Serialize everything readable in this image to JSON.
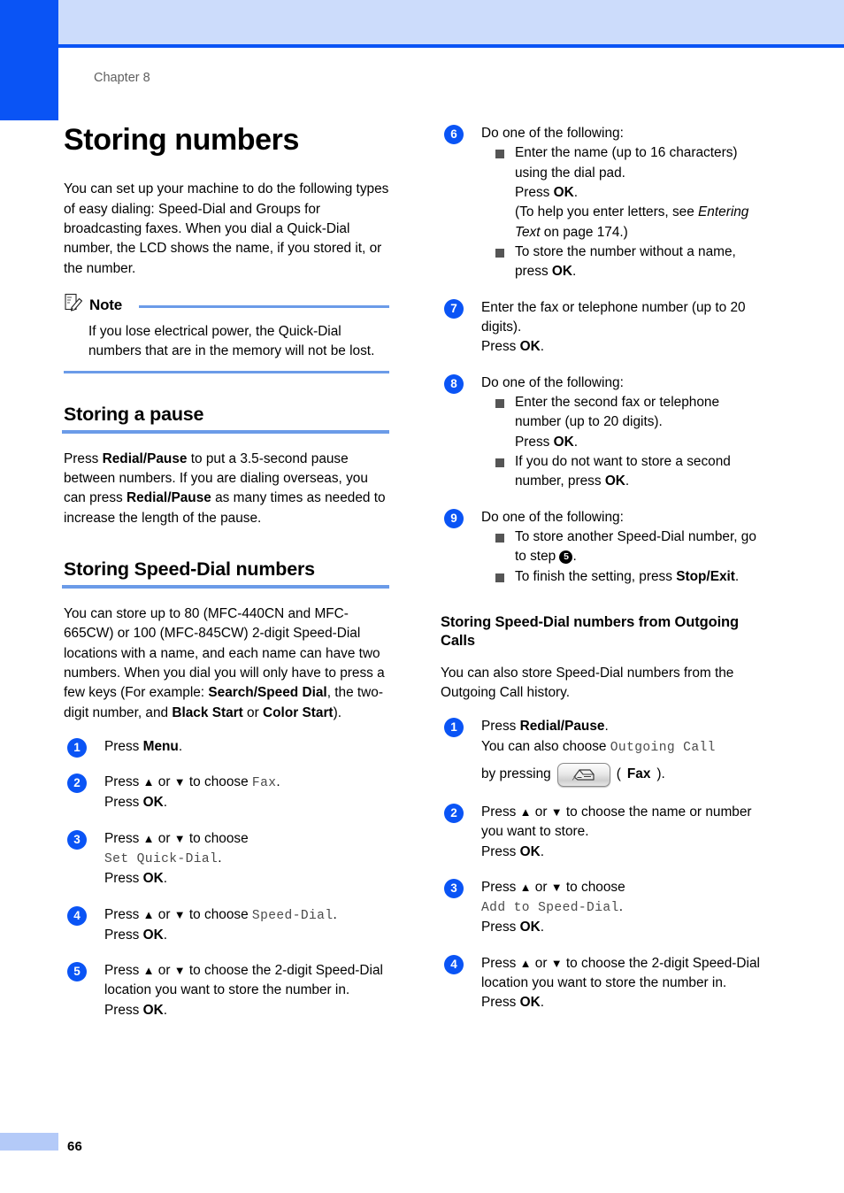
{
  "page": {
    "chapter_label": "Chapter 8",
    "page_number": "66",
    "accent_blue": "#0a54f5",
    "rule_blue": "#6b9be8",
    "band_blue": "#ccdcfb"
  },
  "title": "Storing numbers",
  "intro": "You can set up your machine to do the following types of easy dialing: Speed-Dial and Groups for broadcasting faxes. When you dial a Quick-Dial number, the LCD shows the name, if you stored it, or the number.",
  "note": {
    "title": "Note",
    "body": "If you lose electrical power, the Quick-Dial numbers that are in the memory will not be lost."
  },
  "section_pause": {
    "heading": "Storing a pause",
    "body_1": "Press ",
    "body_b1": "Redial/Pause",
    "body_2": " to put a 3.5-second pause between numbers. If you are dialing overseas, you can press ",
    "body_b2": "Redial/Pause",
    "body_3": " as many times as needed to increase the length of the pause."
  },
  "section_speed_dial": {
    "heading": "Storing Speed-Dial numbers",
    "body_1": "You can store up to 80 (MFC-440CN and MFC-665CW) or 100 (MFC-845CW) 2-digit Speed-Dial locations with a name, and each name can have two numbers. When you dial you will only have to press a few keys (For example: ",
    "body_b1": "Search/Speed Dial",
    "body_2": ", the two-digit number, and ",
    "body_b2": "Black Start",
    "body_3": " or ",
    "body_b3": "Color Start",
    "body_4": ")."
  },
  "steps_left": [
    {
      "num": "1",
      "lines": [
        {
          "parts": [
            {
              "t": "Press "
            },
            {
              "t": "Menu",
              "b": true
            },
            {
              "t": "."
            }
          ]
        }
      ]
    },
    {
      "num": "2",
      "lines": [
        {
          "parts": [
            {
              "t": "Press "
            },
            {
              "t": "▲",
              "arrow": true
            },
            {
              "t": " or "
            },
            {
              "t": "▼",
              "arrow": true
            },
            {
              "t": " to choose "
            },
            {
              "t": "Fax",
              "lcd": true
            },
            {
              "t": "."
            }
          ]
        },
        {
          "parts": [
            {
              "t": "Press "
            },
            {
              "t": "OK",
              "b": true
            },
            {
              "t": "."
            }
          ]
        }
      ]
    },
    {
      "num": "3",
      "lines": [
        {
          "parts": [
            {
              "t": "Press "
            },
            {
              "t": "▲",
              "arrow": true
            },
            {
              "t": " or "
            },
            {
              "t": "▼",
              "arrow": true
            },
            {
              "t": " to choose"
            }
          ]
        },
        {
          "parts": [
            {
              "t": "Set Quick-Dial",
              "lcd": true
            },
            {
              "t": "."
            }
          ]
        },
        {
          "parts": [
            {
              "t": "Press "
            },
            {
              "t": "OK",
              "b": true
            },
            {
              "t": "."
            }
          ]
        }
      ]
    },
    {
      "num": "4",
      "lines": [
        {
          "parts": [
            {
              "t": "Press "
            },
            {
              "t": "▲",
              "arrow": true
            },
            {
              "t": " or "
            },
            {
              "t": "▼",
              "arrow": true
            },
            {
              "t": " to choose "
            },
            {
              "t": "Speed-Dial",
              "lcd": true
            },
            {
              "t": "."
            }
          ]
        },
        {
          "parts": [
            {
              "t": "Press "
            },
            {
              "t": "OK",
              "b": true
            },
            {
              "t": "."
            }
          ]
        }
      ]
    },
    {
      "num": "5",
      "lines": [
        {
          "parts": [
            {
              "t": "Press "
            },
            {
              "t": "▲",
              "arrow": true
            },
            {
              "t": " or "
            },
            {
              "t": "▼",
              "arrow": true
            },
            {
              "t": " to choose the 2-digit Speed-Dial location you want to store the number in."
            }
          ]
        },
        {
          "parts": [
            {
              "t": "Press "
            },
            {
              "t": "OK",
              "b": true
            },
            {
              "t": "."
            }
          ]
        }
      ]
    }
  ],
  "steps_right": [
    {
      "num": "6",
      "lines": [
        {
          "parts": [
            {
              "t": "Do one of the following:"
            }
          ]
        }
      ],
      "bullets": [
        {
          "lines": [
            {
              "parts": [
                {
                  "t": "Enter the name (up to 16 characters) using the dial pad."
                }
              ]
            },
            {
              "parts": [
                {
                  "t": "Press "
                },
                {
                  "t": "OK",
                  "b": true
                },
                {
                  "t": "."
                }
              ]
            },
            {
              "parts": [
                {
                  "t": " (To help you enter letters, see "
                },
                {
                  "t": "Entering Text",
                  "i": true
                },
                {
                  "t": " on page 174.)"
                }
              ]
            }
          ]
        },
        {
          "lines": [
            {
              "parts": [
                {
                  "t": "To store the number without a name, press "
                },
                {
                  "t": "OK",
                  "b": true
                },
                {
                  "t": "."
                }
              ]
            }
          ]
        }
      ]
    },
    {
      "num": "7",
      "lines": [
        {
          "parts": [
            {
              "t": "Enter the fax or telephone number (up to 20 digits)."
            }
          ]
        },
        {
          "parts": [
            {
              "t": "Press "
            },
            {
              "t": "OK",
              "b": true
            },
            {
              "t": "."
            }
          ]
        }
      ]
    },
    {
      "num": "8",
      "lines": [
        {
          "parts": [
            {
              "t": "Do one of the following:"
            }
          ]
        }
      ],
      "bullets": [
        {
          "lines": [
            {
              "parts": [
                {
                  "t": "Enter the second fax or telephone number (up to 20 digits)."
                }
              ]
            },
            {
              "parts": [
                {
                  "t": "Press "
                },
                {
                  "t": "OK",
                  "b": true
                },
                {
                  "t": "."
                }
              ]
            }
          ]
        },
        {
          "lines": [
            {
              "parts": [
                {
                  "t": "If you do not want to store a second number, press "
                },
                {
                  "t": "OK",
                  "b": true
                },
                {
                  "t": "."
                }
              ]
            }
          ]
        }
      ]
    },
    {
      "num": "9",
      "lines": [
        {
          "parts": [
            {
              "t": "Do one of the following:"
            }
          ]
        }
      ],
      "bullets": [
        {
          "lines": [
            {
              "parts": [
                {
                  "t": "To store another Speed-Dial number, go to step "
                },
                {
                  "t": "5",
                  "ref": true
                },
                {
                  "t": "."
                }
              ]
            }
          ]
        },
        {
          "lines": [
            {
              "parts": [
                {
                  "t": "To finish the setting, press "
                },
                {
                  "t": "Stop/Exit",
                  "b": true
                },
                {
                  "t": "."
                }
              ]
            }
          ]
        }
      ]
    }
  ],
  "section_outgoing": {
    "heading": "Storing Speed-Dial numbers from Outgoing Calls",
    "body": "You can also store Speed-Dial numbers from the Outgoing Call history."
  },
  "steps_outgoing": [
    {
      "num": "1",
      "lines": [
        {
          "parts": [
            {
              "t": "Press "
            },
            {
              "t": "Redial/Pause",
              "b": true
            },
            {
              "t": "."
            }
          ]
        },
        {
          "parts": [
            {
              "t": "You can also choose "
            },
            {
              "t": "Outgoing Call",
              "lcd": true
            }
          ]
        }
      ],
      "key_line": {
        "prefix": "by pressing ",
        "key_icon": "fax-key-icon",
        "suffix_b": "Fax",
        "suffix_open": " (",
        "suffix_close": ")."
      }
    },
    {
      "num": "2",
      "lines": [
        {
          "parts": [
            {
              "t": "Press "
            },
            {
              "t": "▲",
              "arrow": true
            },
            {
              "t": " or "
            },
            {
              "t": "▼",
              "arrow": true
            },
            {
              "t": " to choose the name or number you want to store."
            }
          ]
        },
        {
          "parts": [
            {
              "t": "Press "
            },
            {
              "t": "OK",
              "b": true
            },
            {
              "t": "."
            }
          ]
        }
      ]
    },
    {
      "num": "3",
      "lines": [
        {
          "parts": [
            {
              "t": "Press "
            },
            {
              "t": "▲",
              "arrow": true
            },
            {
              "t": " or "
            },
            {
              "t": "▼",
              "arrow": true
            },
            {
              "t": " to choose"
            }
          ]
        },
        {
          "parts": [
            {
              "t": "Add to Speed-Dial",
              "lcd": true
            },
            {
              "t": "."
            }
          ]
        },
        {
          "parts": [
            {
              "t": "Press "
            },
            {
              "t": "OK",
              "b": true
            },
            {
              "t": "."
            }
          ]
        }
      ]
    },
    {
      "num": "4",
      "lines": [
        {
          "parts": [
            {
              "t": "Press "
            },
            {
              "t": "▲",
              "arrow": true
            },
            {
              "t": " or "
            },
            {
              "t": "▼",
              "arrow": true
            },
            {
              "t": " to choose the 2-digit Speed-Dial location you want to store the number in."
            }
          ]
        },
        {
          "parts": [
            {
              "t": "Press "
            },
            {
              "t": "OK",
              "b": true
            },
            {
              "t": "."
            }
          ]
        }
      ]
    }
  ]
}
